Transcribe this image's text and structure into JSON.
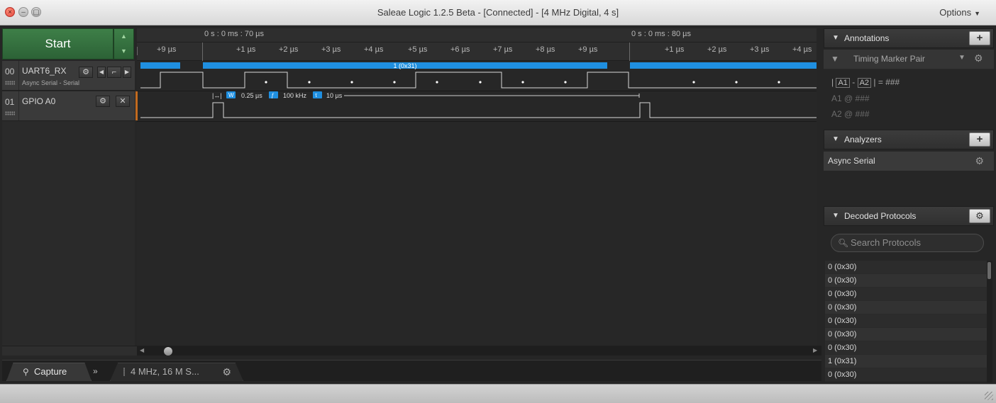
{
  "window": {
    "title": "Saleae Logic 1.2.5 Beta - [Connected] - [4 MHz Digital, 4 s]",
    "options_label": "Options"
  },
  "capture": {
    "start_label": "Start"
  },
  "channels": [
    {
      "num": "00",
      "name": "UART6_RX",
      "sub": "Async Serial - Serial"
    },
    {
      "num": "01",
      "name": "GPIO A0",
      "sub": ""
    }
  ],
  "timeline": {
    "marker_a": "0 s : 0 ms : 70 µs",
    "marker_b": "0 s : 0 ms : 80 µs",
    "ticks": [
      "+9 µs",
      "+1 µs",
      "+2 µs",
      "+3 µs",
      "+4 µs",
      "+5 µs",
      "+6 µs",
      "+7 µs",
      "+8 µs",
      "+9 µs",
      "+1 µs",
      "+2 µs",
      "+3 µs",
      "+4 µs"
    ],
    "decoded_label": "1 (0x31)",
    "measure": {
      "width": "0.25 µs",
      "freq": "100 kHz",
      "period": "10 µs"
    }
  },
  "bottom": {
    "capture_tab": "Capture",
    "rate_tab": "4 MHz, 16 M S..."
  },
  "annotations": {
    "header": "Annotations",
    "marker_pair": "Timing Marker Pair",
    "a1": "A1",
    "a2": "A2",
    "eq_tail": "= ###",
    "a1_line": "A1  @  ###",
    "a2_line": "A2  @  ###"
  },
  "analyzers": {
    "header": "Analyzers",
    "items": [
      "Async Serial"
    ]
  },
  "decoded": {
    "header": "Decoded Protocols",
    "search_placeholder": "Search Protocols",
    "rows": [
      "0 (0x30)",
      "0 (0x30)",
      "0 (0x30)",
      "0 (0x30)",
      "0 (0x30)",
      "0 (0x30)",
      "0 (0x30)",
      "1 (0x31)",
      "0 (0x30)"
    ]
  },
  "icons": {
    "close": "close-icon",
    "minimize": "minimize-icon",
    "maximize": "maximize-icon",
    "gear": "gear-icon",
    "plus": "plus-icon",
    "search": "search-icon",
    "pin": "pin-icon",
    "triangle": "disclosure-triangle-icon"
  },
  "colors": {
    "start_green": "#2c6236",
    "decoded_blue": "#1f8fe0",
    "marker_orange": "#c26a1f"
  }
}
